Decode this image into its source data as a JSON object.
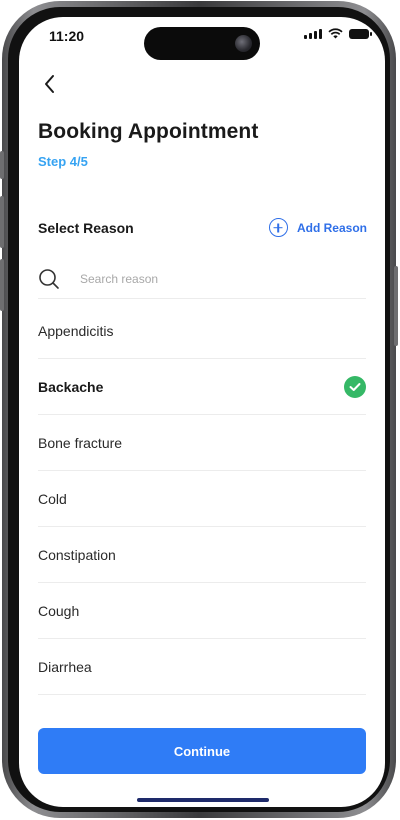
{
  "status": {
    "time": "11:20"
  },
  "header": {
    "title": "Booking Appointment",
    "step": "Step 4/5"
  },
  "section": {
    "label": "Select Reason",
    "add_label": "Add Reason"
  },
  "search": {
    "placeholder": "Search reason",
    "value": ""
  },
  "reasons": [
    {
      "label": "Appendicitis",
      "selected": false
    },
    {
      "label": "Backache",
      "selected": true
    },
    {
      "label": "Bone fracture",
      "selected": false
    },
    {
      "label": "Cold",
      "selected": false
    },
    {
      "label": "Constipation",
      "selected": false
    },
    {
      "label": "Cough",
      "selected": false
    },
    {
      "label": "Diarrhea",
      "selected": false
    }
  ],
  "footer": {
    "continue_label": "Continue"
  },
  "colors": {
    "accent": "#2f7cf6",
    "step": "#36a3f2",
    "selected_check": "#35b866"
  }
}
